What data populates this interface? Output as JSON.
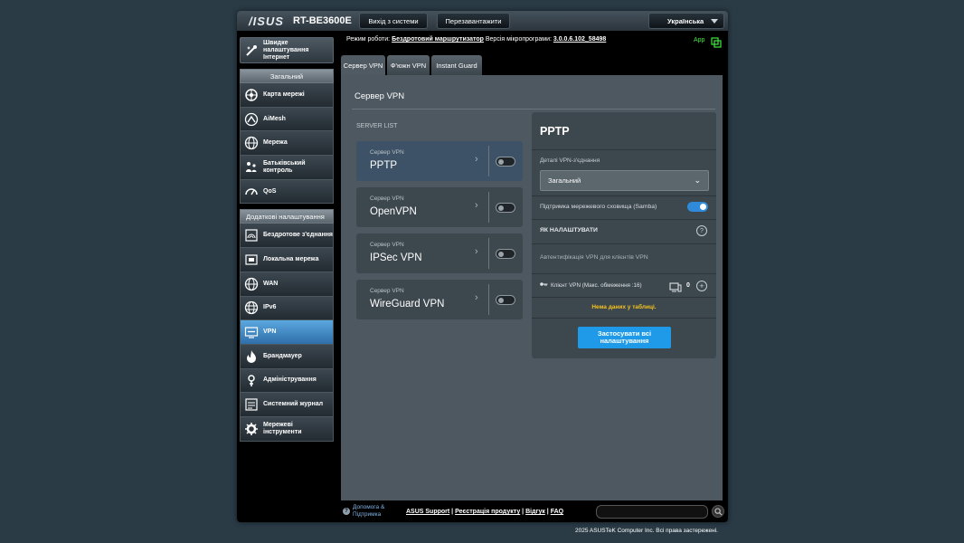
{
  "header": {
    "logo": "/ISUS",
    "model": "RT-BE3600E",
    "logout_label": "Вихід з системи",
    "reboot_label": "Перезавантажити",
    "language": "Українська"
  },
  "sidebar": {
    "quick_internet": "Швидке налаштування Інтернет",
    "general_title": "Загальний",
    "general_items": [
      {
        "label": "Карта мережі",
        "icon": "network-map-icon"
      },
      {
        "label": "AiMesh",
        "icon": "aimesh-icon"
      },
      {
        "label": "Мережа",
        "icon": "globe-icon"
      },
      {
        "label": "Батьківський контроль",
        "icon": "parental-control-icon"
      },
      {
        "label": "QoS",
        "icon": "qos-icon"
      }
    ],
    "advanced_title": "Додаткові налаштування",
    "advanced_items": [
      {
        "label": "Бездротове з'єднання",
        "icon": "wireless-icon"
      },
      {
        "label": "Локальна мережа",
        "icon": "lan-icon"
      },
      {
        "label": "WAN",
        "icon": "wan-globe-icon"
      },
      {
        "label": "IPv6",
        "icon": "ipv6-globe-icon"
      },
      {
        "label": "VPN",
        "icon": "vpn-icon"
      },
      {
        "label": "Брандмауер",
        "icon": "firewall-icon"
      },
      {
        "label": "Адміністрування",
        "icon": "admin-icon"
      },
      {
        "label": "Системний журнал",
        "icon": "system-log-icon"
      },
      {
        "label": "Мережеві інструменти",
        "icon": "network-tools-icon"
      }
    ]
  },
  "status": {
    "mode_label": "Режим роботи:",
    "mode_value": "Бездротовий маршрутизатор",
    "firmware_label": "Версія мікропрограми:",
    "firmware_value": "3.0.0.6.102_58498",
    "app_label": "App"
  },
  "tabs": [
    "Сервер VPN",
    "Ф'южн VPN",
    "Instant Guard"
  ],
  "content": {
    "title": "Сервер VPN",
    "server_list_label": "SERVER LIST",
    "servers": [
      {
        "sub": "Сервер VPN",
        "name": "PPTP",
        "enabled": false
      },
      {
        "sub": "Сервер VPN",
        "name": "OpenVPN",
        "enabled": false
      },
      {
        "sub": "Сервер VPN",
        "name": "IPSec VPN",
        "enabled": false
      },
      {
        "sub": "Сервер VPN",
        "name": "WireGuard VPN",
        "enabled": false
      }
    ]
  },
  "detail": {
    "title": "PPTP",
    "details_label": "Деталі VPN-з'єднання",
    "select_value": "Загальний",
    "samba_label": "Підтримка мережевого сховища (Samba)",
    "samba_enabled": true,
    "how_to_label": "ЯК НАЛАШТУВАТИ",
    "auth_label": "Автентифікація VPN для клієнтів VPN",
    "client_label": "Клієнт VPN (Макс. обмеження :16)",
    "client_count": "0",
    "no_data": "Нема даних у таблиці.",
    "apply_label": "Застосувати всі налаштування"
  },
  "footer": {
    "help_label": "Допомога & Підтримка",
    "links": [
      "ASUS Support",
      "Реєстрація продукту",
      "Відгук",
      "FAQ"
    ],
    "copyright": "2025 ASUSTeK Computer Inc. Всі права застережені."
  },
  "colors": {
    "accent": "#1e9ae8",
    "active_nav": "#4a97d4",
    "toggle_on": "#2f8bd9",
    "warning_text": "#f4c21f",
    "app_green": "#3ee83e"
  }
}
